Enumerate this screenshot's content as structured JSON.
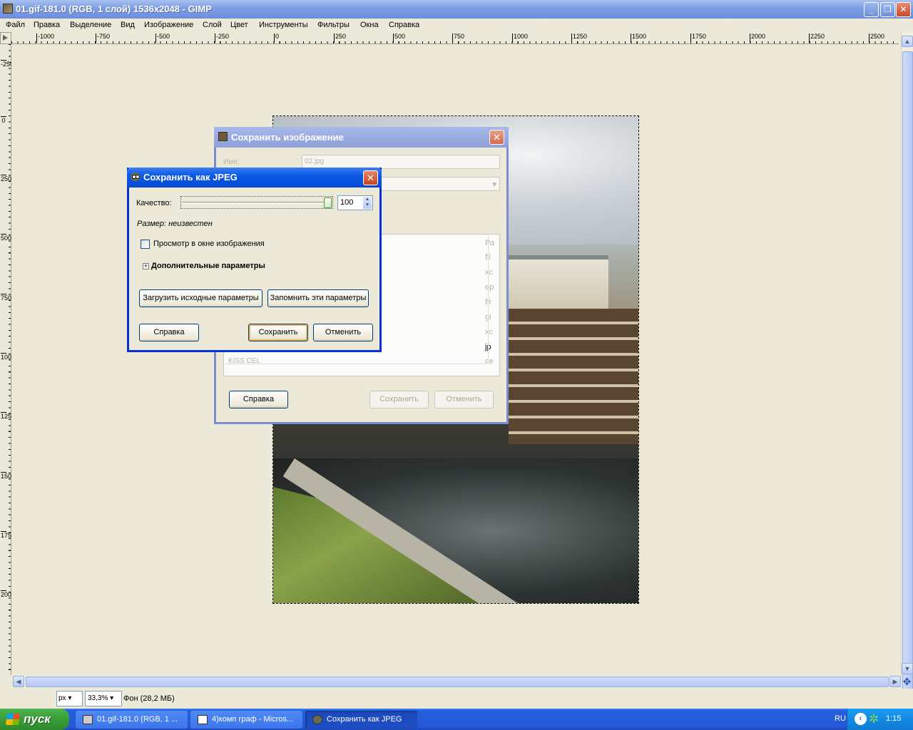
{
  "window": {
    "title": "01.gif-181.0 (RGB, 1 слой) 1536x2048 - GIMP",
    "controls": {
      "minimize": "_",
      "maximize": "❐",
      "close": "✕"
    }
  },
  "menubar": [
    "Файл",
    "Правка",
    "Выделение",
    "Вид",
    "Изображение",
    "Слой",
    "Цвет",
    "Инструменты",
    "Фильтры",
    "Окна",
    "Справка"
  ],
  "ruler_h": [
    "-1000",
    "-750",
    "-500",
    "-250",
    "0",
    "250",
    "500",
    "750",
    "1000",
    "1250",
    "1500",
    "1750",
    "2000",
    "2250",
    "2500"
  ],
  "ruler_v": [
    "-250",
    "0",
    "250",
    "500",
    "750",
    "1000",
    "1250",
    "1500",
    "1750",
    "2000"
  ],
  "status": {
    "unit": "px",
    "zoom": "33,3%",
    "layer": "Фон (28,2 МБ)"
  },
  "save_dialog": {
    "title": "Сохранить изображение",
    "name_label": "Имя:",
    "name_value": "02.jpg",
    "list_column": "Ра",
    "list_items": [
      "fli",
      "xc",
      "ep",
      "fit",
      "gi",
      "xc",
      "jp",
      "ce"
    ],
    "list_partial": "KISS CEL",
    "help": "Справка",
    "save": "Сохранить",
    "cancel": "Отменить"
  },
  "jpeg_dialog": {
    "title": "Сохранить как JPEG",
    "quality_label": "Качество:",
    "quality_value": "100",
    "quality_fraction": 1.0,
    "size_text": "Размер: неизвестен",
    "preview_label": "Просмотр в окне изображения",
    "advanced_label": "Дополнительные параметры",
    "load_defaults": "Загрузить исходные параметры",
    "save_defaults": "Запомнить эти параметры",
    "help": "Справка",
    "save": "Сохранить",
    "cancel": "Отменить"
  },
  "taskbar": {
    "start": "пуск",
    "tasks": [
      "01.gif-181.0 (RGB, 1 ...",
      "4)комп граф - Micros...",
      "Сохранить как JPEG"
    ],
    "lang": "RU",
    "clock": "1:15"
  }
}
